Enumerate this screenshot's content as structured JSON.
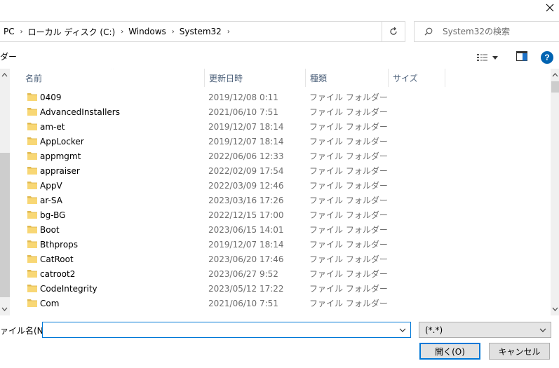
{
  "addressbar": {
    "crumbs": [
      "PC",
      "ローカル ディスク (C:)",
      "Windows",
      "System32"
    ],
    "search_placeholder": "System32の検索"
  },
  "toolbar": {
    "left_label": "ダー"
  },
  "columns": {
    "name": "名前",
    "date": "更新日時",
    "type": "種類",
    "size": "サイズ"
  },
  "files": [
    {
      "name": "0409",
      "date": "2019/12/08 0:11",
      "type": "ファイル フォルダー"
    },
    {
      "name": "AdvancedInstallers",
      "date": "2021/06/10 7:51",
      "type": "ファイル フォルダー"
    },
    {
      "name": "am-et",
      "date": "2019/12/07 18:14",
      "type": "ファイル フォルダー"
    },
    {
      "name": "AppLocker",
      "date": "2019/12/07 18:14",
      "type": "ファイル フォルダー"
    },
    {
      "name": "appmgmt",
      "date": "2022/06/06 12:33",
      "type": "ファイル フォルダー"
    },
    {
      "name": "appraiser",
      "date": "2022/02/09 17:54",
      "type": "ファイル フォルダー"
    },
    {
      "name": "AppV",
      "date": "2022/03/09 12:46",
      "type": "ファイル フォルダー"
    },
    {
      "name": "ar-SA",
      "date": "2023/03/16 17:26",
      "type": "ファイル フォルダー"
    },
    {
      "name": "bg-BG",
      "date": "2022/12/15 17:00",
      "type": "ファイル フォルダー"
    },
    {
      "name": "Boot",
      "date": "2023/06/15 14:01",
      "type": "ファイル フォルダー"
    },
    {
      "name": "Bthprops",
      "date": "2019/12/07 18:14",
      "type": "ファイル フォルダー"
    },
    {
      "name": "CatRoot",
      "date": "2023/06/20 17:46",
      "type": "ファイル フォルダー"
    },
    {
      "name": "catroot2",
      "date": "2023/06/27 9:52",
      "type": "ファイル フォルダー"
    },
    {
      "name": "CodeIntegrity",
      "date": "2023/05/12 17:22",
      "type": "ファイル フォルダー"
    },
    {
      "name": "Com",
      "date": "2021/06/10 7:51",
      "type": "ファイル フォルダー"
    }
  ],
  "bottom": {
    "filename_label": "ァイル名(N):",
    "filename_value": "",
    "filter_value": "(*.*)",
    "open_label": "開く(O)",
    "cancel_label": "キャンセル"
  },
  "colors": {
    "accent": "#0078d7",
    "folder": "#f8d775",
    "folder_dark": "#e0b94f",
    "help": "#0063b1"
  }
}
